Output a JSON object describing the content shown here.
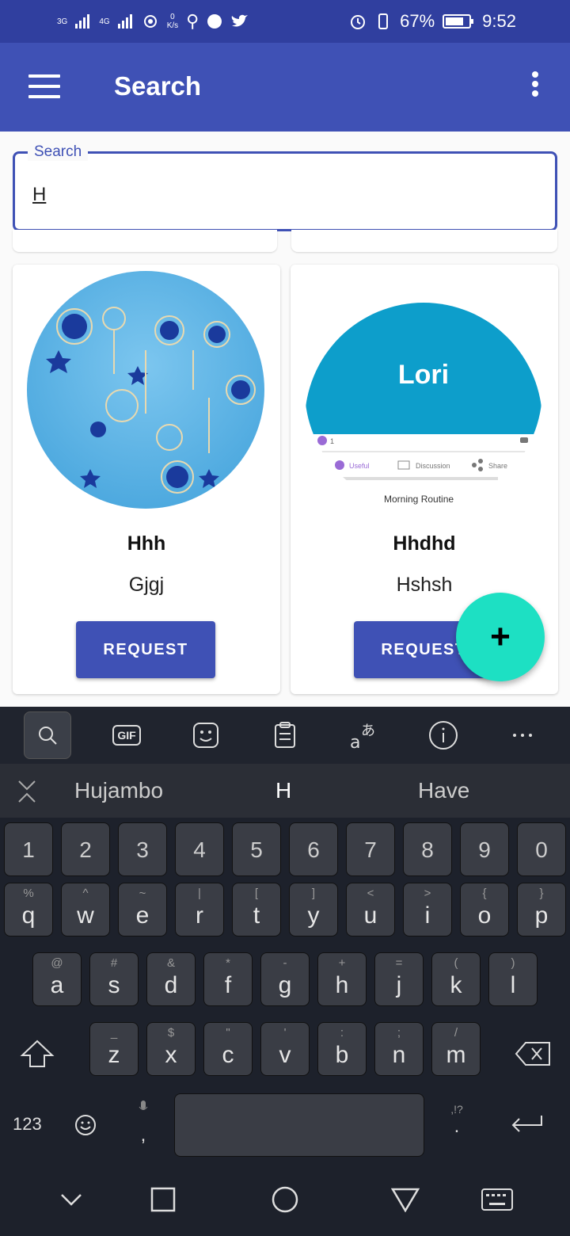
{
  "status": {
    "net1": "3G",
    "net2": "4G",
    "speed_value": "0",
    "speed_unit": "K/s",
    "battery": "67%",
    "time": "9:52"
  },
  "appbar": {
    "title": "Search"
  },
  "search": {
    "label": "Search",
    "value": "H"
  },
  "cards": [
    {
      "name": "Hhh",
      "desc": "Gjgj",
      "button": "REQUEST",
      "image": "earrings"
    },
    {
      "name": "Hhdhd",
      "desc": "Hshsh",
      "button": "REQUEST",
      "image": "lori",
      "image_text": {
        "title": "Lori",
        "count": "1",
        "useful": "Useful",
        "discussion": "Discussion",
        "share": "Share",
        "caption": "Morning Routine"
      }
    }
  ],
  "fab": {
    "icon": "plus-icon",
    "label": "+"
  },
  "keyboard": {
    "toolbar": [
      "search-icon",
      "gif-icon",
      "sticker-icon",
      "clipboard-icon",
      "translate-icon",
      "info-icon",
      "more-icon"
    ],
    "gif_label": "GIF",
    "suggestions": [
      "Hujambo",
      "H",
      "Have"
    ],
    "numbers": [
      "1",
      "2",
      "3",
      "4",
      "5",
      "6",
      "7",
      "8",
      "9",
      "0"
    ],
    "row1": [
      {
        "m": "q",
        "s": "%"
      },
      {
        "m": "w",
        "s": "^"
      },
      {
        "m": "e",
        "s": "~"
      },
      {
        "m": "r",
        "s": "|"
      },
      {
        "m": "t",
        "s": "["
      },
      {
        "m": "y",
        "s": "]"
      },
      {
        "m": "u",
        "s": "<"
      },
      {
        "m": "i",
        "s": ">"
      },
      {
        "m": "o",
        "s": "{"
      },
      {
        "m": "p",
        "s": "}"
      }
    ],
    "row2": [
      {
        "m": "a",
        "s": "@"
      },
      {
        "m": "s",
        "s": "#"
      },
      {
        "m": "d",
        "s": "&"
      },
      {
        "m": "f",
        "s": "*"
      },
      {
        "m": "g",
        "s": "-"
      },
      {
        "m": "h",
        "s": "+"
      },
      {
        "m": "j",
        "s": "="
      },
      {
        "m": "k",
        "s": "("
      },
      {
        "m": "l",
        "s": ")"
      }
    ],
    "row3": [
      {
        "m": "z",
        "s": "_"
      },
      {
        "m": "x",
        "s": "$"
      },
      {
        "m": "c",
        "s": "\""
      },
      {
        "m": "v",
        "s": "'"
      },
      {
        "m": "b",
        "s": ":"
      },
      {
        "m": "n",
        "s": ";"
      },
      {
        "m": "m",
        "s": "/"
      }
    ],
    "bottom": {
      "numbers_key": "123",
      "comma": ",",
      "period": ".",
      "period_sub": ",!?"
    }
  },
  "navbar": [
    "back-icon",
    "recents-icon",
    "home-icon",
    "back-triangle-icon",
    "keyboard-icon"
  ]
}
